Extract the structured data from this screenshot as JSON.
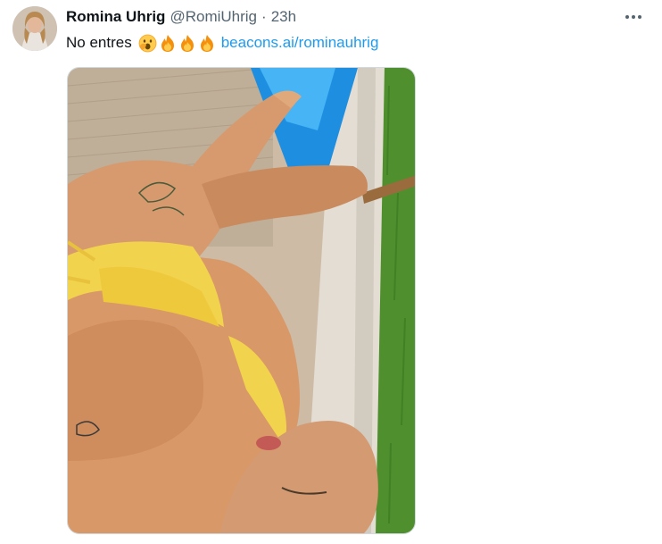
{
  "tweet": {
    "display_name": "Romina Uhrig",
    "handle": "@RomiUhrig",
    "separator": "·",
    "time": "23h",
    "text": "No entres",
    "emojis": [
      "face-with-hand-over-mouth-emoji",
      "fire-emoji",
      "fire-emoji",
      "fire-emoji"
    ],
    "link": "beacons.ai/rominauhrig"
  },
  "icons": {
    "more": "more-horizontal-icon"
  },
  "colors": {
    "link": "#1d9bf0",
    "secondary_text": "#536471",
    "primary_text": "#0f1419"
  }
}
